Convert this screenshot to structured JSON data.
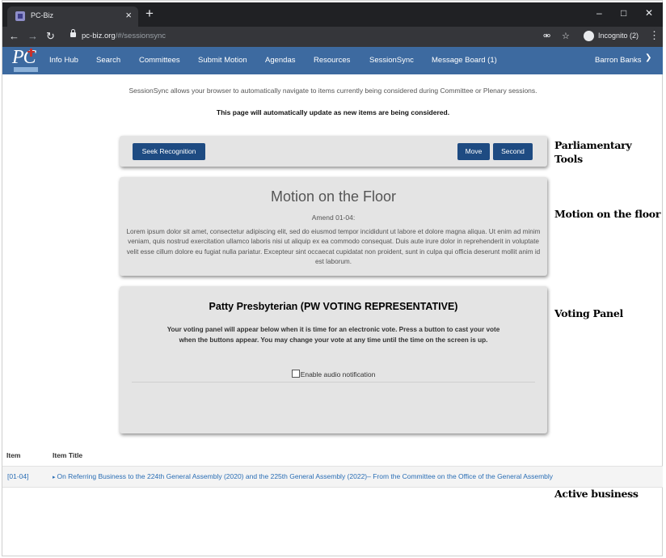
{
  "browser": {
    "tab_title": "PC-Biz",
    "tab_close": "×",
    "new_tab": "+",
    "url_host": "pc-biz.org",
    "url_path": "/#/sessionsync",
    "incognito_label": "Incognito (2)",
    "icons": [
      "back-arrow-icon",
      "forward-arrow-icon",
      "reload-icon",
      "lock-icon",
      "key-icon",
      "star-icon",
      "incognito-icon",
      "menu-dots-icon"
    ]
  },
  "nav": {
    "items": [
      {
        "label": "Info Hub"
      },
      {
        "label": "Search"
      },
      {
        "label": "Committees"
      },
      {
        "label": "Submit Motion"
      },
      {
        "label": "Agendas"
      },
      {
        "label": "Resources"
      },
      {
        "label": "SessionSync"
      },
      {
        "label": "Message Board (1)"
      }
    ],
    "user": "Barron Banks",
    "colors": {
      "navbar": "#3d6aa0",
      "button": "#1e4b82",
      "link": "#2a6eb5"
    }
  },
  "intro": {
    "text": "SessionSync allows your browser to automatically navigate to items currently being considered during Committee or Plenary sessions.",
    "auto_update": "This page will automatically update as new items are being considered."
  },
  "tools": {
    "seek": "Seek Recognition",
    "move": "Move",
    "second": "Second"
  },
  "motion": {
    "title": "Motion on the Floor",
    "amend": "Amend 01-04:",
    "body": "Lorem ipsum dolor sit amet, consectetur adipiscing elit, sed do eiusmod tempor incididunt ut labore et dolore magna aliqua. Ut enim ad minim veniam, quis nostrud exercitation ullamco laboris nisi ut aliquip ex ea commodo consequat. Duis aute irure dolor in reprehenderit in voluptate velit esse cillum dolore eu fugiat nulla pariatur. Excepteur sint occaecat cupidatat non proident, sunt in culpa qui officia deserunt mollit anim id est laborum."
  },
  "voting": {
    "voter": "Patty Presbyterian (PW VOTING REPRESENTATIVE)",
    "instructions": "Your voting panel will appear below when it is time for an electronic vote. Press a button to cast your vote when the buttons appear. You may change your vote at any time until the time on the screen is up.",
    "audio_label": "Enable audio notification",
    "audio_checked": false
  },
  "annotations": {
    "tools": "Parliamentary Tools",
    "motion": "Motion on the floor",
    "voting": "Voting Panel",
    "business": "Active business"
  },
  "business": {
    "columns": [
      "Item",
      "Item Title"
    ],
    "rows": [
      {
        "id": "[01-04]",
        "title": "On Referring Business to the 224th General Assembly (2020) and the 225th General Assembly (2022)– From the Committee on the Office of the General Assembly"
      }
    ]
  }
}
